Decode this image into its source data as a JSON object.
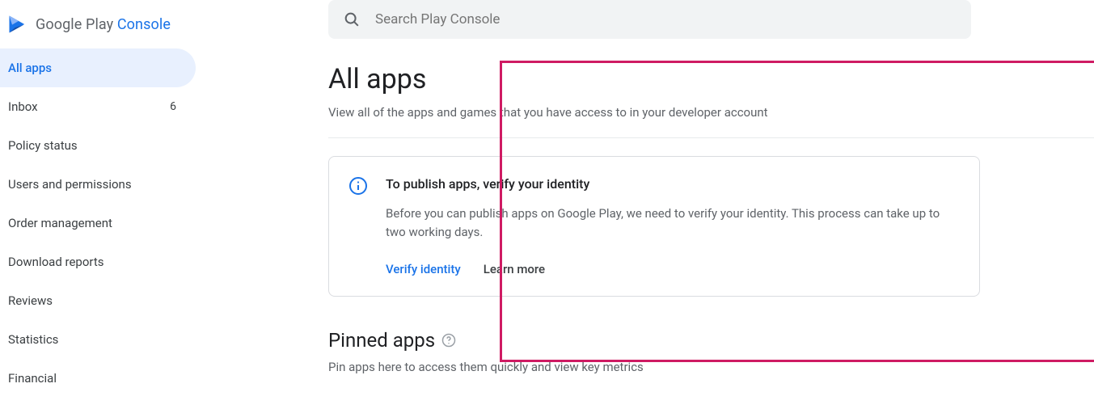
{
  "logo": {
    "text1": "Google Play",
    "text2": " Console"
  },
  "sidebar": {
    "items": [
      {
        "label": "All apps",
        "badge": ""
      },
      {
        "label": "Inbox",
        "badge": "6"
      },
      {
        "label": "Policy status",
        "badge": ""
      },
      {
        "label": "Users and permissions",
        "badge": ""
      },
      {
        "label": "Order management",
        "badge": ""
      },
      {
        "label": "Download reports",
        "badge": ""
      },
      {
        "label": "Reviews",
        "badge": ""
      },
      {
        "label": "Statistics",
        "badge": ""
      },
      {
        "label": "Financial",
        "badge": ""
      }
    ]
  },
  "search": {
    "placeholder": "Search Play Console"
  },
  "page": {
    "title": "All apps",
    "subtitle": "View all of the apps and games that you have access to in your developer account"
  },
  "card": {
    "title": "To publish apps, verify your identity",
    "body": "Before you can publish apps on Google Play, we need to verify your identity. This process can take up to two working days.",
    "primary": "Verify identity",
    "secondary": "Learn more"
  },
  "pinned": {
    "title": "Pinned apps",
    "subtitle": "Pin apps here to access them quickly and view key metrics"
  }
}
